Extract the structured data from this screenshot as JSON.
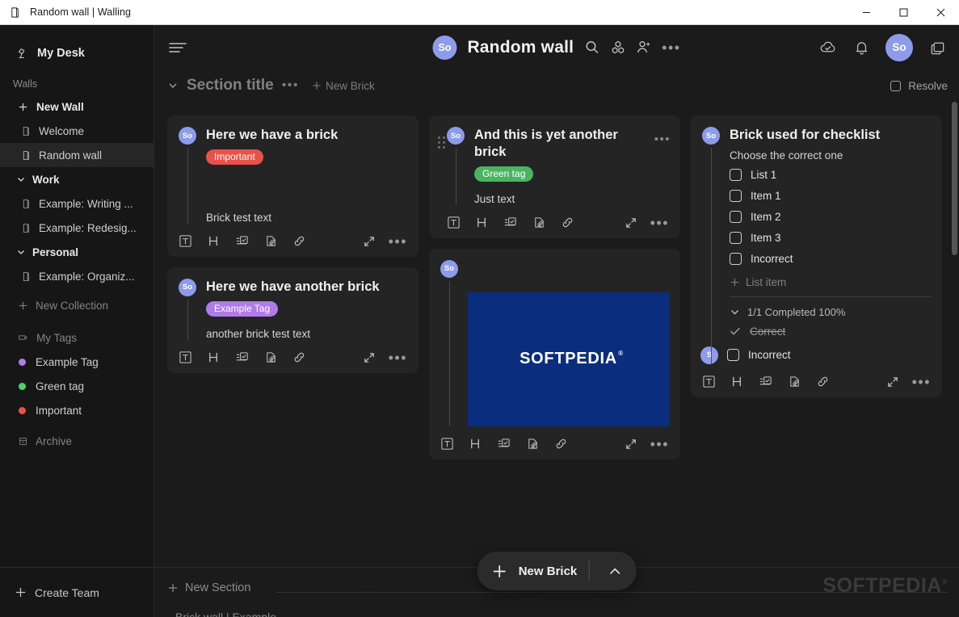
{
  "window": {
    "title": "Random wall | Walling",
    "app_icon": "book-icon",
    "controls": {
      "minimize": "minimize-icon",
      "maximize": "maximize-icon",
      "close": "close-icon"
    }
  },
  "sidebar": {
    "my_desk": {
      "label": "My Desk",
      "icon": "desk-lamp-icon"
    },
    "walls_label": "Walls",
    "items": [
      {
        "label": "New Wall",
        "icon": "plus-icon",
        "style": "new"
      },
      {
        "label": "Welcome",
        "icon": "book-icon",
        "style": "item"
      },
      {
        "label": "Random wall",
        "icon": "book-icon",
        "style": "active"
      },
      {
        "label": "Work",
        "icon": "chevron-down-icon",
        "style": "group"
      },
      {
        "label": "Example: Writing ...",
        "icon": "book-icon",
        "style": "item"
      },
      {
        "label": "Example: Redesig...",
        "icon": "book-icon",
        "style": "item"
      },
      {
        "label": "Personal",
        "icon": "chevron-down-icon",
        "style": "group"
      },
      {
        "label": "Example: Organiz...",
        "icon": "book-icon",
        "style": "item"
      },
      {
        "label": "New Collection",
        "icon": "plus-icon",
        "style": "muted"
      }
    ],
    "my_tags": {
      "label": "My Tags",
      "icon": "tag-icon"
    },
    "tags": [
      {
        "label": "Example Tag",
        "color": "#b07ce8"
      },
      {
        "label": "Green tag",
        "color": "#4ad36c"
      },
      {
        "label": "Important",
        "color": "#e8524a"
      }
    ],
    "archive": {
      "label": "Archive",
      "icon": "archive-icon"
    },
    "create_team": {
      "label": "Create Team",
      "icon": "plus-icon"
    }
  },
  "topbar": {
    "menu_icon": "hamburger-icon",
    "avatar_initials": "So",
    "wall_title": "Random wall",
    "search_icon": "search-icon",
    "blocks_icon": "blocks-icon",
    "add_member_icon": "add-person-icon",
    "more_icon": "more-horizontal-icon",
    "cloud_icon": "cloud-check-icon",
    "bell_icon": "bell-icon",
    "user_avatar_initials": "So",
    "layers_icon": "copy-layers-icon"
  },
  "section": {
    "collapse_icon": "chevron-down-icon",
    "title": "Section title",
    "more_icon": "more-horizontal-icon",
    "new_brick_label": "New Brick",
    "resolve_label": "Resolve"
  },
  "toolbar_icons": {
    "text": "text-box-icon",
    "heading": "heading-icon",
    "checklist": "checklist-icon",
    "attachment": "attachment-icon",
    "link": "link-icon",
    "expand": "expand-icon",
    "more": "more-horizontal-icon"
  },
  "cards": {
    "brick1": {
      "avatar_initials": "So",
      "title": "Here we have a brick",
      "tag": {
        "label": "Important",
        "color": "#e8524a"
      },
      "text": "Brick test text"
    },
    "brick2": {
      "avatar_initials": "So",
      "title": "Here we have another brick",
      "tag": {
        "label": "Example Tag",
        "color": "#b07ce8"
      },
      "text": "another brick test text"
    },
    "brick3": {
      "avatar_initials": "So",
      "title": "And this is yet another brick",
      "tag": {
        "label": "Green tag",
        "color": "#4ab463"
      },
      "text": "Just text"
    },
    "image_brick": {
      "avatar_initials": "So",
      "image_label": "SOFTPEDIA",
      "image_bg": "#0b2d7e"
    },
    "checklist": {
      "avatar_initials": "So",
      "title": "Brick used for checklist",
      "subtitle": "Choose the correct one",
      "items": [
        {
          "label": "List 1",
          "checked": false
        },
        {
          "label": "Item 1",
          "checked": false
        },
        {
          "label": "Item 2",
          "checked": false
        },
        {
          "label": "Item 3",
          "checked": false
        },
        {
          "label": "Incorrect",
          "checked": false
        }
      ],
      "add_item_label": "List item",
      "completed_summary": "1/1 Completed 100%",
      "completed_item": "Correct",
      "last_item": {
        "label": "Incorrect",
        "avatar_initials": "S"
      }
    }
  },
  "fab": {
    "label": "New Brick",
    "plus_icon": "plus-icon",
    "chevron_icon": "chevron-up-icon"
  },
  "footer": {
    "new_section_label": "New Section",
    "watermark": "SOFTPEDIA",
    "cut_text": "Brick wall | Example"
  }
}
